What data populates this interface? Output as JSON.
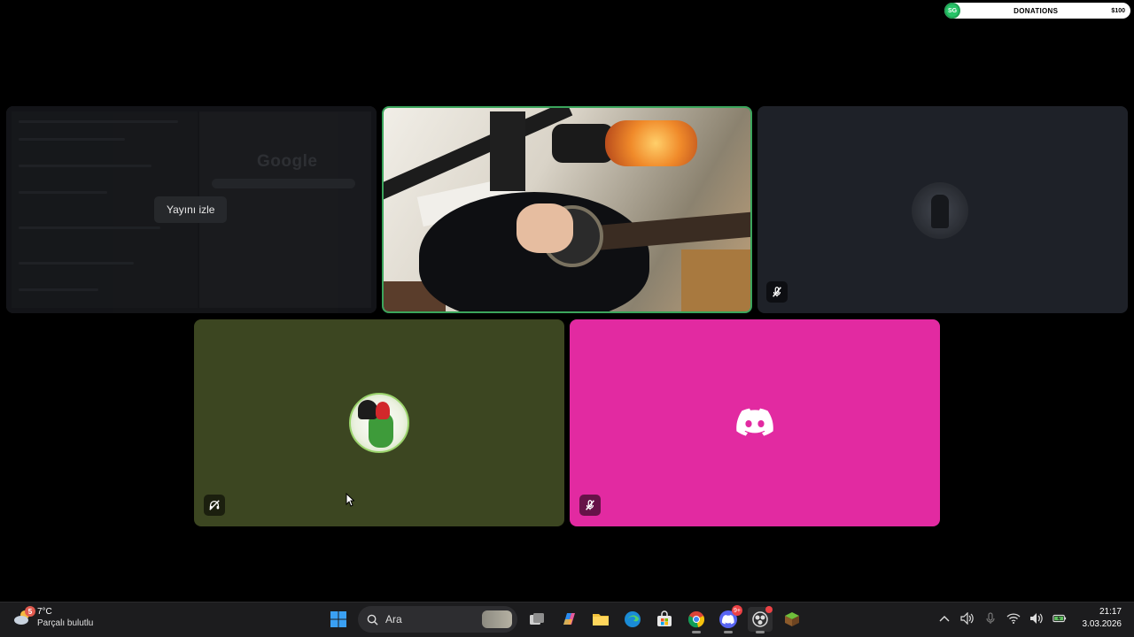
{
  "donations_widget": {
    "avatar_text": "SG",
    "title": "DONATIONS",
    "amount": "$100"
  },
  "screen_share_tile": {
    "watch_label": "Yayını izle",
    "preview_text": "Google"
  },
  "tiles": [
    {
      "id": "screen-share",
      "muted": false
    },
    {
      "id": "camera",
      "muted": false,
      "speaking": true
    },
    {
      "id": "user-3",
      "muted": true
    },
    {
      "id": "user-4",
      "muted": true,
      "mute_kind": "deafened"
    },
    {
      "id": "user-5",
      "muted": true
    }
  ],
  "colors": {
    "speaking_border": "#3ba55c",
    "tile_dark": "#1e2128",
    "tile_olive": "#3c4621",
    "tile_pink": "#e22aa1"
  },
  "taskbar": {
    "weather": {
      "temp": "7°C",
      "description": "Parçalı bulutlu",
      "badge": "5"
    },
    "search_placeholder": "Ara",
    "apps": [
      "windows-start-icon",
      "task-view-icon",
      "copilot-icon",
      "file-explorer-icon",
      "edge-icon",
      "store-icon",
      "chrome-icon",
      "discord-icon",
      "obs-icon",
      "minecraft-icon"
    ],
    "discord_badge": "9+",
    "clock": {
      "time": "21:17",
      "date": "3.03.2026"
    }
  }
}
